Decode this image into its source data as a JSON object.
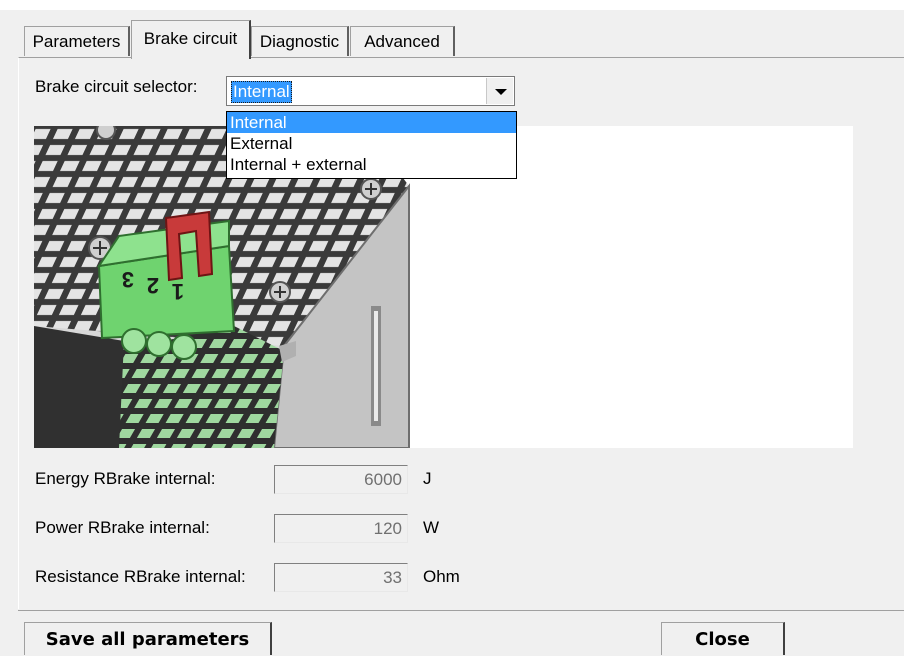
{
  "tabs": [
    {
      "label": "Parameters",
      "active": false
    },
    {
      "label": "Brake circuit",
      "active": true
    },
    {
      "label": "Diagnostic",
      "active": false
    },
    {
      "label": "Advanced",
      "active": false
    }
  ],
  "brake_circuit": {
    "selector_label": "Brake circuit selector:",
    "selected_value": "Internal",
    "options": [
      "Internal",
      "External",
      "Internal + external"
    ],
    "terminal_labels": [
      "3",
      "2",
      "1"
    ]
  },
  "fields": [
    {
      "label": "Energy RBrake internal:",
      "value": "6000",
      "unit": "J"
    },
    {
      "label": "Power RBrake internal:",
      "value": "120",
      "unit": "W"
    },
    {
      "label": "Resistance RBrake internal:",
      "value": "33",
      "unit": "Ohm"
    }
  ],
  "buttons": {
    "save_label": "Save all parameters",
    "close_label": "Close"
  },
  "colors": {
    "selection": "#3399ff",
    "connector_green": "#6fd36f",
    "jumper_red": "#c83a3a"
  }
}
